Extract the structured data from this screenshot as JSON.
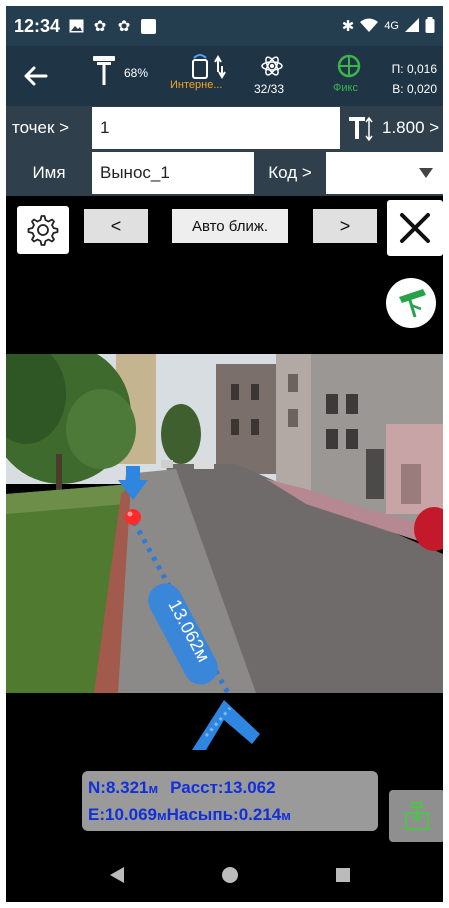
{
  "status_bar": {
    "time": "12:34",
    "network_type": "4G"
  },
  "gnss": {
    "battery": "68%",
    "connection": "Интерне...",
    "satellites": "32/33",
    "solution": "Фикс",
    "precision_h": "П: 0,016",
    "precision_v": "В: 0,020"
  },
  "point_row": {
    "label": "точек >",
    "value": "1",
    "antenna_height": "1.800 >"
  },
  "name_row": {
    "name_label": "Имя",
    "name_value": "Вынос_1",
    "code_label": "Код >"
  },
  "ar_controls": {
    "prev": "<",
    "next": ">",
    "mode": "Авто ближ."
  },
  "distance_label": "13.062м",
  "readout": {
    "north_label": "N:",
    "north_value": "8.321",
    "unit_m": "м",
    "distance_label": "Расст:",
    "distance_value": "13.062",
    "east_label": "E:",
    "east_value": "10.069",
    "fill_label": "Насыпь:",
    "fill_value": "0.214"
  },
  "colors": {
    "toolbar_bg": "#1f3445",
    "status_bg": "#243d4f",
    "accent_blue": "#1e7fd6",
    "readout_text": "#1230d8",
    "fix_green": "#3bb54a",
    "net_orange": "#f5a623"
  }
}
